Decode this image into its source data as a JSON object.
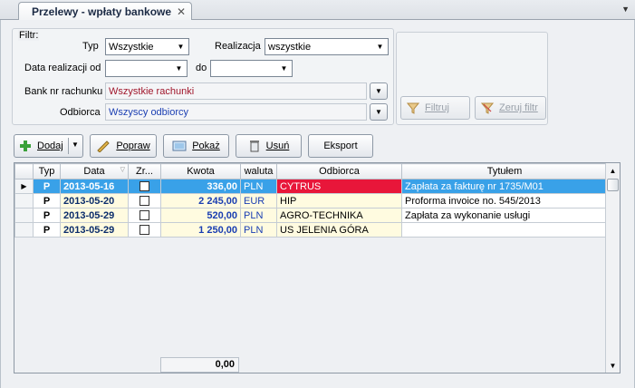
{
  "tab": {
    "title": "Przelewy - wpłaty bankowe",
    "close": "✕",
    "menu": "▼"
  },
  "filter": {
    "title": "Filtr:",
    "typ_label": "Typ",
    "typ_value": "Wszystkie",
    "realizacja_label": "Realizacja",
    "realizacja_value": "wszystkie",
    "date_from_label": "Data realizacji od",
    "date_from_value": "",
    "date_to_label": "do",
    "date_to_value": "",
    "bank_label": "Bank nr rachunku",
    "bank_value": "Wszystkie rachunki",
    "odbiorca_label": "Odbiorca",
    "odbiorca_value": "Wszyscy odbiorcy",
    "filtruj_label": "Filtruj",
    "zeruj_label": "Zeruj filtr"
  },
  "toolbar": {
    "dodaj": "Dodaj",
    "popraw": "Popraw",
    "pokaz": "Pokaż",
    "usun": "Usuń",
    "eksport": "Eksport"
  },
  "grid": {
    "columns": [
      "",
      "Typ",
      "Data",
      "Zr...",
      "Kwota",
      "waluta",
      "Odbiorca",
      "Tytułem"
    ],
    "rows": [
      {
        "indicator": "▶",
        "typ": "P",
        "data": "2013-05-16",
        "kwota": "336,00",
        "waluta": "PLN",
        "odbiorca": "CYTRUS",
        "tytulem": "Zapłata za fakturę nr 1735/M01",
        "selected": true
      },
      {
        "indicator": "",
        "typ": "P",
        "data": "2013-05-20",
        "kwota": "2 245,00",
        "waluta": "EUR",
        "odbiorca": "HIP",
        "tytulem": "Proforma invoice no. 545/2013",
        "selected": false
      },
      {
        "indicator": "",
        "typ": "P",
        "data": "2013-05-29",
        "kwota": "520,00",
        "waluta": "PLN",
        "odbiorca": "AGRO-TECHNIKA",
        "tytulem": "Zapłata za wykonanie usługi",
        "selected": false
      },
      {
        "indicator": "",
        "typ": "P",
        "data": "2013-05-29",
        "kwota": "1 250,00",
        "waluta": "PLN",
        "odbiorca": "US JELENIA GÓRA",
        "tytulem": "",
        "selected": false
      }
    ],
    "sum": "0,00"
  }
}
